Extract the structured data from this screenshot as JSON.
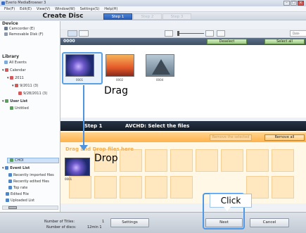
{
  "window": {
    "title": "Everio MediaBrowser 3"
  },
  "menu": {
    "items": [
      "File(F)",
      "Edit(E)",
      "View(V)",
      "Window(W)",
      "Settings(S)",
      "Help(H)"
    ]
  },
  "header": {
    "title": "Create Disc",
    "steps": [
      "Step 1",
      "Step 2",
      "Step 3"
    ],
    "active_step": 0
  },
  "sidebar": {
    "device_heading": "Device",
    "device_items": [
      "Camcorder (E)",
      "Removable Disk (F)"
    ],
    "library_heading": "Library",
    "library_items": [
      "All Events",
      "Calendar",
      "2011",
      "9/2011 (3)",
      "9/28/2011 (3)"
    ],
    "user_list_heading": "User List",
    "user_list_items": [
      "Untitled",
      "CHOI"
    ],
    "event_heading": "Event List",
    "event_items": [
      "Recently imported files",
      "Recently edited files",
      "Top rate",
      "Edited File",
      "Uploaded List"
    ]
  },
  "toolbar": {
    "date_placeholder": "Date"
  },
  "upper": {
    "title": "0000",
    "deselect_label": "Deselect",
    "select_all_label": "Select all",
    "thumbs": [
      {
        "label": "0001"
      },
      {
        "label": "0002"
      },
      {
        "label": "0004"
      }
    ]
  },
  "lower": {
    "step_label": "Step 1",
    "title": "AVCHD: Select the files",
    "remove_selected_label": "Remove the selected",
    "remove_all_label": "Remove all",
    "drop_hint": "Drag and Drop files here",
    "dropped_label": "0001"
  },
  "annotations": {
    "drag": "Drag",
    "drop": "Drop",
    "click": "Click"
  },
  "bottom": {
    "num_titles_label": "Number of Titles:",
    "num_titles_value": "1",
    "num_discs_label": "Number of discs:",
    "num_discs_value": "12min 1",
    "settings_label": "Settings",
    "next_label": "Next",
    "cancel_label": "Cancel"
  },
  "colors": {
    "accent": "#2b5fb8",
    "highlight": "#4d95e0",
    "drop_zone": "#ffb24a"
  }
}
